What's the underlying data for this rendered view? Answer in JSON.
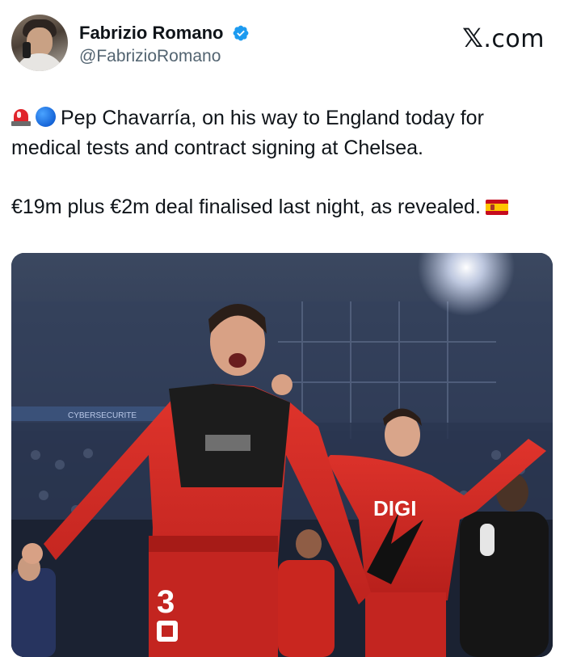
{
  "author": {
    "display_name": "Fabrizio Romano",
    "handle": "@FabrizioRomano",
    "verified": true,
    "avatar_icon": "profile-photo"
  },
  "brand": {
    "label": ".com",
    "logo_icon": "x-logo-icon"
  },
  "tweet": {
    "line1_emojis": [
      "police-car-light-icon",
      "blue-circle-icon"
    ],
    "paragraph1": "Pep Chavarría, on his way to England today for medical tests and contract signing at Chelsea.",
    "paragraph2": "€19m plus €2m deal finalised last night, as revealed.",
    "paragraph2_emoji": "spain-flag-icon"
  },
  "media": {
    "kind": "photo",
    "banner_text": "CYBERSECURITE",
    "shirt_sponsor": "DIGI",
    "shirt_number": "3",
    "colors": {
      "kit_red": "#d42a24",
      "stadium_blue": "#2a3a55"
    }
  }
}
